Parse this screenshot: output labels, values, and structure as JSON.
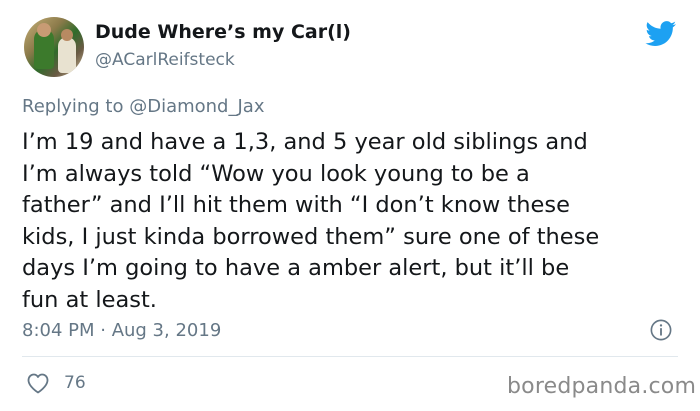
{
  "author": {
    "display_name": "Dude Where’s my Car(l)",
    "handle": "@ACarlReifsteck",
    "avatar_icon": "avatar-photo"
  },
  "reply": {
    "prefix": "Replying to ",
    "mention": "@Diamond_Jax"
  },
  "tweet": {
    "lines": [
      "I’m 19 and have a 1,3, and 5 year old siblings and",
      "I’m always told “Wow you look young to be a",
      "father” and I’ll hit them with “I don’t know these",
      "kids, I just kinda borrowed them” sure one of these",
      "days I’m going to have a amber alert, but it’ll be",
      "fun at least."
    ],
    "timestamp": "8:04 PM · Aug 3, 2019"
  },
  "engagement": {
    "likes": "76"
  },
  "watermark": "boredpanda.com",
  "icons": {
    "brand": "twitter-bird-icon",
    "info": "info-icon",
    "like": "heart-icon"
  },
  "colors": {
    "twitter_blue": "#1da1f2",
    "text_primary": "#14171a",
    "text_secondary": "#657786"
  }
}
